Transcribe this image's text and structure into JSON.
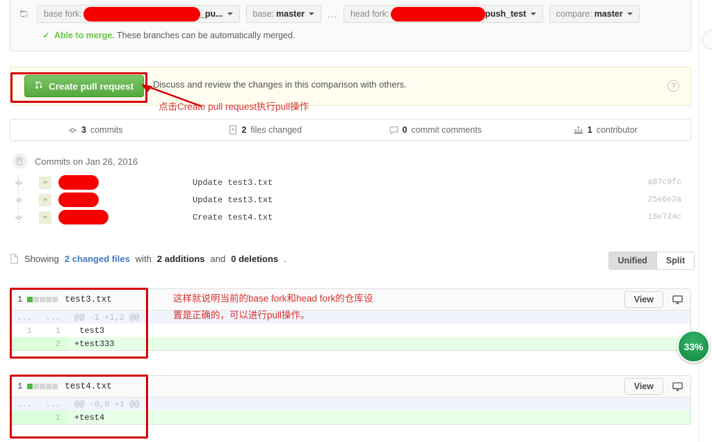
{
  "compare": {
    "sync_icon": "compare-sync-icon",
    "base_fork": {
      "label": "base fork:",
      "value_redacted": true,
      "value_suffix": "_pu...",
      "redact_width": 168
    },
    "base_branch": {
      "label": "base:",
      "value": "master"
    },
    "separator": "...",
    "head_fork": {
      "label": "head fork:",
      "value_redacted": true,
      "value_suffix": "push_test",
      "redact_width": 136
    },
    "compare_branch": {
      "label": "compare:",
      "value": "master"
    },
    "merge_status": {
      "check": "✓",
      "strong": "Able to merge.",
      "rest": "These branches can be automatically merged."
    }
  },
  "banner": {
    "button_label": "Create pull request",
    "button_icon": "pull-request-icon",
    "description": "Discuss and review the changes in this comparison with others.",
    "help_icon": "?"
  },
  "annotations": {
    "pr_note": "点击Create pull request执行pull操作",
    "diff_note_line1": "这样就说明当前的base fork和head fork的仓库设",
    "diff_note_line2": "置是正确的，可以进行pull操作。",
    "color": "#d8332e",
    "box_color": "#d40000"
  },
  "stats": [
    {
      "icon": "commit-icon",
      "count": "3",
      "label": "commits"
    },
    {
      "icon": "file-diff-icon",
      "count": "2",
      "label": "files changed"
    },
    {
      "icon": "comment-icon",
      "count": "0",
      "label": "commit comments"
    },
    {
      "icon": "organization-icon",
      "count": "1",
      "label": "contributor"
    }
  ],
  "commits_section": {
    "icon": "commit-group-icon",
    "heading": "Commits on Jan 26, 2016",
    "rows": [
      {
        "author_redacted": true,
        "redact_width": 58,
        "message": "Update test3.txt",
        "sha": "a87c9fc"
      },
      {
        "author_redacted": true,
        "redact_width": 58,
        "message": "Update test3.txt",
        "sha": "25e6e2a"
      },
      {
        "author_redacted": true,
        "redact_width": 72,
        "message": "Create test4.txt",
        "sha": "18e724c"
      }
    ]
  },
  "showing": {
    "icon": "file-icon",
    "prefix": "Showing",
    "changed_files_link": "2 changed files",
    "mid": "with",
    "additions": "2 additions",
    "and": "and",
    "deletions": "0 deletions",
    "period": ".",
    "view_modes": [
      {
        "label": "Unified",
        "active": true
      },
      {
        "label": "Split",
        "active": false
      }
    ]
  },
  "diffs": [
    {
      "count": "1",
      "bars": [
        "add",
        "none",
        "none",
        "none",
        "none"
      ],
      "filename": "test3.txt",
      "view_label": "View",
      "monitor_icon": "display-icon",
      "rows": [
        {
          "type": "hunk",
          "old": "...",
          "new": "...",
          "code": "@@ -1 +1,2 @@"
        },
        {
          "type": "ctx",
          "old": "1",
          "new": "1",
          "code": " test3"
        },
        {
          "type": "add",
          "old": "",
          "new": "2",
          "code": "+test333"
        }
      ]
    },
    {
      "count": "1",
      "bars": [
        "add",
        "none",
        "none",
        "none",
        "none"
      ],
      "filename": "test4.txt",
      "view_label": "View",
      "monitor_icon": "display-icon",
      "rows": [
        {
          "type": "hunk",
          "old": "...",
          "new": "...",
          "code": "@@ -0,0 +1 @@"
        },
        {
          "type": "add",
          "old": "",
          "new": "1",
          "code": "+test4"
        }
      ]
    }
  ],
  "overlays": {
    "zoom_badge": "33%"
  }
}
